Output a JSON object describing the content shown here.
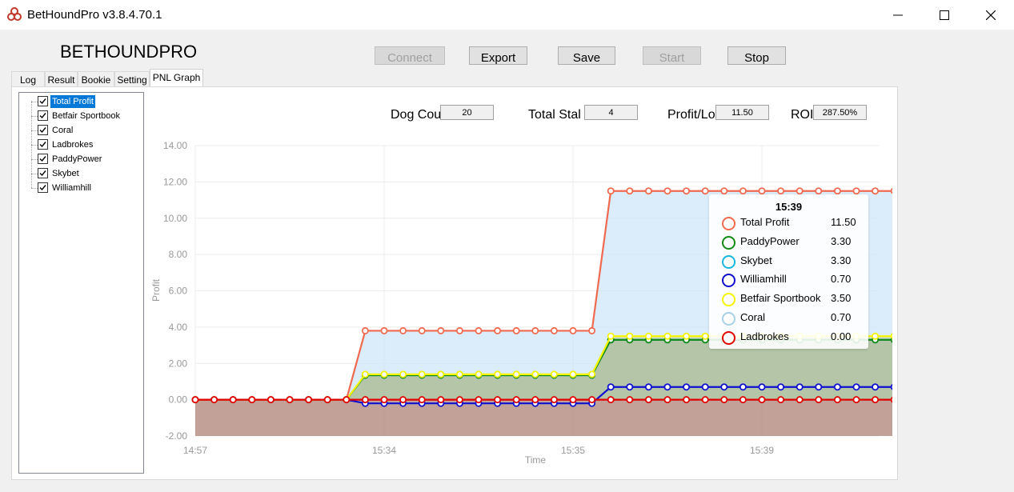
{
  "window": {
    "title": "BetHoundPro v3.8.4.70.1"
  },
  "brand": "BETHOUNDPRO",
  "toolbar": {
    "connect": "Connect",
    "export": "Export",
    "save": "Save",
    "start": "Start",
    "stop": "Stop"
  },
  "tabs": [
    "Log",
    "Result",
    "Bookie",
    "Setting",
    "PNL Graph"
  ],
  "active_tab": "PNL Graph",
  "tree": {
    "items": [
      "Total Profit",
      "Betfair Sportbook",
      "Coral",
      "Ladbrokes",
      "PaddyPower",
      "Skybet",
      "Williamhill"
    ],
    "selected": "Total Profit"
  },
  "stats": {
    "dog_count_label": "Dog Cou",
    "dog_count": "20",
    "total_stake_label": "Total Stal",
    "total_stake": "4",
    "profit_loss_label": "Profit/Lo",
    "profit_loss": "11.50",
    "roi_label": "ROI",
    "roi": "287.50%"
  },
  "tooltip": {
    "time": "15:39",
    "rows": [
      {
        "name": "Total Profit",
        "value": "11.50",
        "color": "#f06a50"
      },
      {
        "name": "PaddyPower",
        "value": "3.30",
        "color": "#148a14"
      },
      {
        "name": "Skybet",
        "value": "3.30",
        "color": "#1ab6e0"
      },
      {
        "name": "Williamhill",
        "value": "0.70",
        "color": "#1010cc"
      },
      {
        "name": "Betfair Sportbook",
        "value": "3.50",
        "color": "#f5f500"
      },
      {
        "name": "Coral",
        "value": "0.70",
        "color": "#a8d0e6"
      },
      {
        "name": "Ladbrokes",
        "value": "0.00",
        "color": "#e00000"
      }
    ]
  },
  "chart_data": {
    "type": "area",
    "xlabel": "Time",
    "ylabel": "Profit",
    "ylim": [
      -2,
      14
    ],
    "yticks": [
      "14.00",
      "12.00",
      "10.00",
      "8.00",
      "6.00",
      "4.00",
      "2.00",
      "0.00",
      "-2.00"
    ],
    "xticks": [
      "14:57",
      "15:34",
      "15:35",
      "15:39"
    ],
    "grid": true,
    "series": [
      {
        "name": "Total Profit",
        "color": "#f06a50",
        "values": [
          0,
          0,
          0,
          0,
          0,
          0,
          0,
          0,
          0,
          3.8,
          3.8,
          3.8,
          3.8,
          3.8,
          3.8,
          3.8,
          3.8,
          3.8,
          3.8,
          3.8,
          3.8,
          3.8,
          11.5,
          11.5,
          11.5,
          11.5,
          11.5,
          11.5,
          11.5,
          11.5,
          11.5,
          11.5,
          11.5,
          11.5,
          11.5,
          11.5,
          11.5,
          11.5,
          11.5
        ]
      },
      {
        "name": "Betfair Sportbook",
        "color": "#f5f500",
        "values": [
          0,
          0,
          0,
          0,
          0,
          0,
          0,
          0,
          0,
          1.4,
          1.4,
          1.4,
          1.4,
          1.4,
          1.4,
          1.4,
          1.4,
          1.4,
          1.4,
          1.4,
          1.4,
          1.4,
          3.5,
          3.5,
          3.5,
          3.5,
          3.5,
          3.5,
          3.5,
          3.5,
          3.5,
          3.5,
          3.5,
          3.5,
          3.5,
          3.5,
          3.5,
          3.5,
          3.5
        ]
      },
      {
        "name": "PaddyPower",
        "color": "#148a14",
        "values": [
          0,
          0,
          0,
          0,
          0,
          0,
          0,
          0,
          0,
          1.35,
          1.35,
          1.35,
          1.35,
          1.35,
          1.35,
          1.35,
          1.35,
          1.35,
          1.35,
          1.35,
          1.35,
          1.35,
          3.3,
          3.3,
          3.3,
          3.3,
          3.3,
          3.3,
          3.3,
          3.3,
          3.3,
          3.3,
          3.3,
          3.3,
          3.3,
          3.3,
          3.3,
          3.3,
          3.3
        ]
      },
      {
        "name": "Skybet",
        "color": "#1ab6e0",
        "values": [
          0,
          0,
          0,
          0,
          0,
          0,
          0,
          0,
          0,
          1.35,
          1.35,
          1.35,
          1.35,
          1.35,
          1.35,
          1.35,
          1.35,
          1.35,
          1.35,
          1.35,
          1.35,
          1.35,
          3.3,
          3.3,
          3.3,
          3.3,
          3.3,
          3.3,
          3.3,
          3.3,
          3.3,
          3.3,
          3.3,
          3.3,
          3.3,
          3.3,
          3.3,
          3.3,
          3.3
        ]
      },
      {
        "name": "Williamhill",
        "color": "#1010cc",
        "values": [
          0,
          0,
          0,
          0,
          0,
          0,
          0,
          0,
          0,
          -0.2,
          -0.2,
          -0.2,
          -0.2,
          -0.2,
          -0.2,
          -0.2,
          -0.2,
          -0.2,
          -0.2,
          -0.2,
          -0.2,
          -0.2,
          0.7,
          0.7,
          0.7,
          0.7,
          0.7,
          0.7,
          0.7,
          0.7,
          0.7,
          0.7,
          0.7,
          0.7,
          0.7,
          0.7,
          0.7,
          0.7,
          0.7
        ]
      },
      {
        "name": "Coral",
        "color": "#a8d0e6",
        "values": [
          0,
          0,
          0,
          0,
          0,
          0,
          0,
          0,
          0,
          -0.2,
          -0.2,
          -0.2,
          -0.2,
          -0.2,
          -0.2,
          -0.2,
          -0.2,
          -0.2,
          -0.2,
          -0.2,
          -0.2,
          -0.2,
          0.7,
          0.7,
          0.7,
          0.7,
          0.7,
          0.7,
          0.7,
          0.7,
          0.7,
          0.7,
          0.7,
          0.7,
          0.7,
          0.7,
          0.7,
          0.7,
          0.7
        ]
      },
      {
        "name": "Ladbrokes",
        "color": "#e00000",
        "values": [
          0,
          0,
          0,
          0,
          0,
          0,
          0,
          0,
          0,
          0,
          0,
          0,
          0,
          0,
          0,
          0,
          0,
          0,
          0,
          0,
          0,
          0,
          0,
          0,
          0,
          0,
          0,
          0,
          0,
          0,
          0,
          0,
          0,
          0,
          0,
          0,
          0,
          0,
          0
        ]
      }
    ]
  }
}
